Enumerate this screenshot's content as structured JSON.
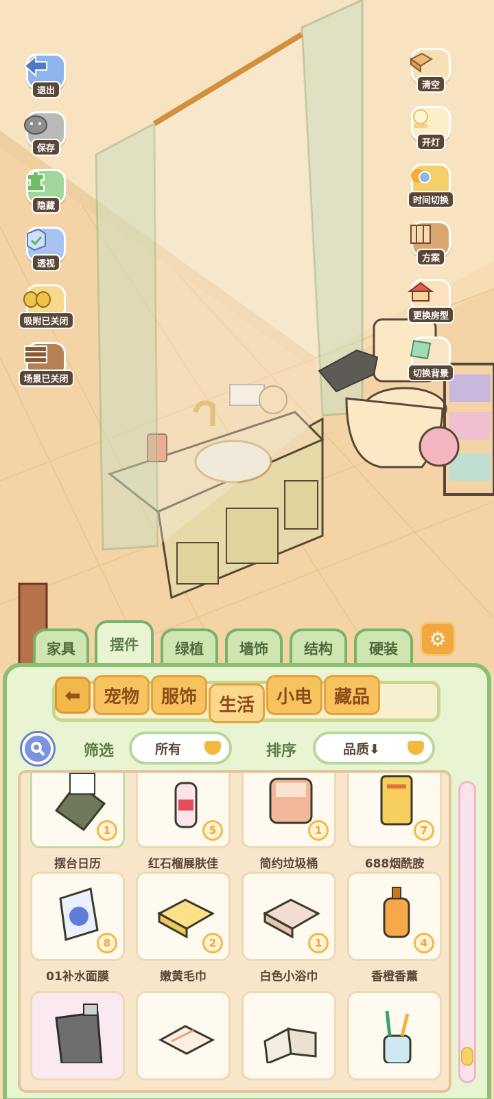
{
  "left_tools": [
    {
      "label": "退出",
      "icon": "exit-arrow-icon"
    },
    {
      "label": "保存",
      "icon": "save-cat-icon"
    },
    {
      "label": "隐藏",
      "icon": "hide-icon"
    },
    {
      "label": "透视",
      "icon": "perspective-cube-icon"
    },
    {
      "label": "吸附已关闭",
      "icon": "snap-chicks-icon"
    },
    {
      "label": "场景已关闭",
      "icon": "scene-fence-icon"
    }
  ],
  "right_tools": [
    {
      "label": "清空",
      "icon": "clear-box-icon"
    },
    {
      "label": "开灯",
      "icon": "light-icon"
    },
    {
      "label": "时间切换",
      "icon": "time-switch-icon"
    },
    {
      "label": "方案",
      "icon": "plan-icon"
    },
    {
      "label": "更换房型",
      "icon": "house-icon"
    },
    {
      "label": "切换背景",
      "icon": "background-icon"
    }
  ],
  "category_tabs": [
    {
      "label": "家具",
      "active": false
    },
    {
      "label": "摆件",
      "active": true
    },
    {
      "label": "绿植",
      "active": false
    },
    {
      "label": "墙饰",
      "active": false
    },
    {
      "label": "结构",
      "active": false
    },
    {
      "label": "硬装",
      "active": false
    }
  ],
  "sub_tabs": [
    {
      "label": "宠物",
      "active": false
    },
    {
      "label": "服饰",
      "active": false
    },
    {
      "label": "生活",
      "active": true
    },
    {
      "label": "小电",
      "active": false
    },
    {
      "label": "藏品",
      "active": false
    }
  ],
  "filter": {
    "label": "筛选",
    "value": "所有"
  },
  "sort": {
    "label": "排序",
    "value": "品质⬇"
  },
  "items": [
    {
      "name": "摆台日历",
      "count": "1",
      "icon": "desk-calendar-icon",
      "selected": true
    },
    {
      "name": "红石榴展肤佳",
      "count": "5",
      "icon": "lotion-bottle-icon"
    },
    {
      "name": "简约垃圾桶",
      "count": "1",
      "icon": "trash-bin-icon"
    },
    {
      "name": "688烟酰胺",
      "count": "7",
      "icon": "serum-box-icon"
    },
    {
      "name": "01补水面膜",
      "count": "8",
      "icon": "face-mask-icon"
    },
    {
      "name": "嫩黄毛巾",
      "count": "2",
      "icon": "yellow-towel-icon"
    },
    {
      "name": "白色小浴巾",
      "count": "1",
      "icon": "white-bath-towel-icon"
    },
    {
      "name": "香橙香薰",
      "count": "4",
      "icon": "orange-aroma-icon"
    },
    {
      "name": "",
      "count": "",
      "icon": "trash-can-icon"
    },
    {
      "name": "",
      "count": "",
      "icon": "folded-towel-icon"
    },
    {
      "name": "",
      "count": "",
      "icon": "open-book-icon"
    },
    {
      "name": "",
      "count": "",
      "icon": "toothbrush-cup-icon"
    }
  ],
  "scroll_fraction": 0.95
}
